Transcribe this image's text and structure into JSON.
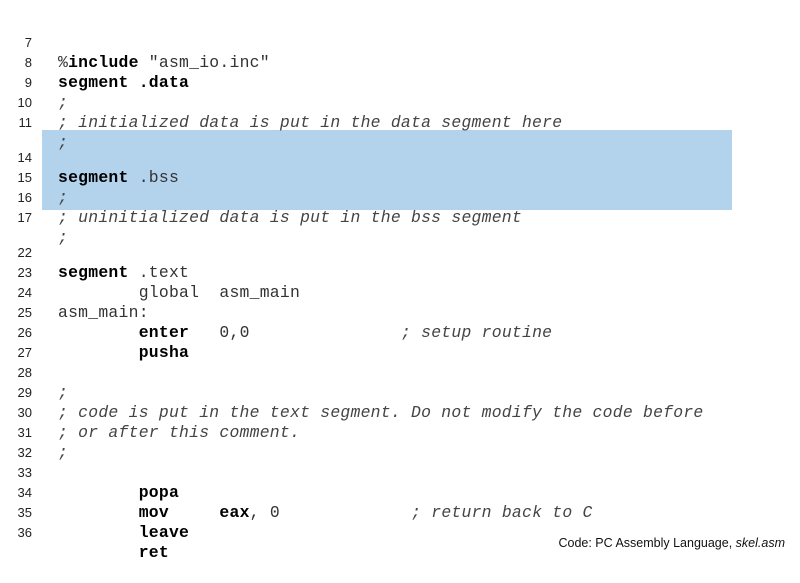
{
  "lines": [
    {
      "num": "7",
      "parts": [
        "%",
        "include",
        " \"asm_io.inc\""
      ]
    },
    {
      "num": "8",
      "parts": [
        "segment",
        " ",
        ".data"
      ]
    },
    {
      "num": "9",
      "parts": [
        ";"
      ]
    },
    {
      "num": "10",
      "parts": [
        "; initialized data is put in the data segment here"
      ]
    },
    {
      "num": "11",
      "parts": [
        ";"
      ]
    },
    {
      "num": "14",
      "parts": [
        "segment",
        " .bss"
      ]
    },
    {
      "num": "15",
      "parts": [
        ";"
      ]
    },
    {
      "num": "16",
      "parts": [
        "; uninitialized data is put in the bss segment"
      ]
    },
    {
      "num": "17",
      "parts": [
        ";"
      ]
    },
    {
      "num": "22",
      "parts": [
        "segment",
        " .text"
      ]
    },
    {
      "num": "23",
      "parts": [
        "        global  asm_main"
      ]
    },
    {
      "num": "24",
      "parts": [
        "asm_main:"
      ]
    },
    {
      "num": "25",
      "parts": [
        "        ",
        "enter",
        "   0,0               ",
        "; setup routine"
      ]
    },
    {
      "num": "26",
      "parts": [
        "        ",
        "pusha"
      ]
    },
    {
      "num": "27",
      "parts": []
    },
    {
      "num": "28",
      "parts": [
        ";"
      ]
    },
    {
      "num": "29",
      "parts": [
        "; code is put in the text segment. Do not modify the code before"
      ]
    },
    {
      "num": "30",
      "parts": [
        "; or after this comment."
      ]
    },
    {
      "num": "31",
      "parts": [
        ";"
      ]
    },
    {
      "num": "32",
      "parts": []
    },
    {
      "num": "33",
      "parts": [
        "        ",
        "popa"
      ]
    },
    {
      "num": "34",
      "parts": [
        "        ",
        "mov",
        "     ",
        "eax",
        ", 0             ",
        "; return back to C"
      ]
    },
    {
      "num": "35",
      "parts": [
        "        ",
        "leave"
      ]
    },
    {
      "num": "36",
      "parts": [
        "        ",
        "ret"
      ]
    }
  ],
  "caption": {
    "prefix": "Code: PC Assembly Language, ",
    "file": "skel.asm"
  },
  "colors": {
    "highlight": "#b3d3ec"
  }
}
